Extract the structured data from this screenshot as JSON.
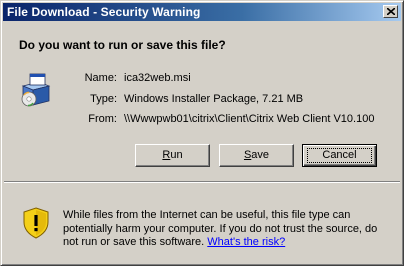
{
  "window": {
    "title": "File Download - Security Warning"
  },
  "prompt": {
    "question": "Do you want to run or save this file?"
  },
  "file": {
    "name_label": "Name:",
    "name_value": "ica32web.msi",
    "type_label": "Type:",
    "type_value": "Windows Installer Package, 7.21 MB",
    "from_label": "From:",
    "from_value": "\\\\Wwwpwb01\\citrix\\Client\\Citrix Web Client V10.100",
    "icon": "installer-package-icon"
  },
  "buttons": {
    "run_accel": "R",
    "run_rest": "un",
    "save_accel": "S",
    "save_rest": "ave",
    "cancel_label": "Cancel"
  },
  "warning": {
    "icon": "shield-warning-icon",
    "text": "While files from the Internet can be useful, this file type can potentially harm your computer. If you do not trust the source, do not run or save this software. ",
    "link": "What's the risk?"
  },
  "colors": {
    "title_gradient_start": "#0a246a",
    "title_gradient_end": "#a6caf0",
    "face": "#d4d0c8",
    "link": "#0000ff"
  }
}
